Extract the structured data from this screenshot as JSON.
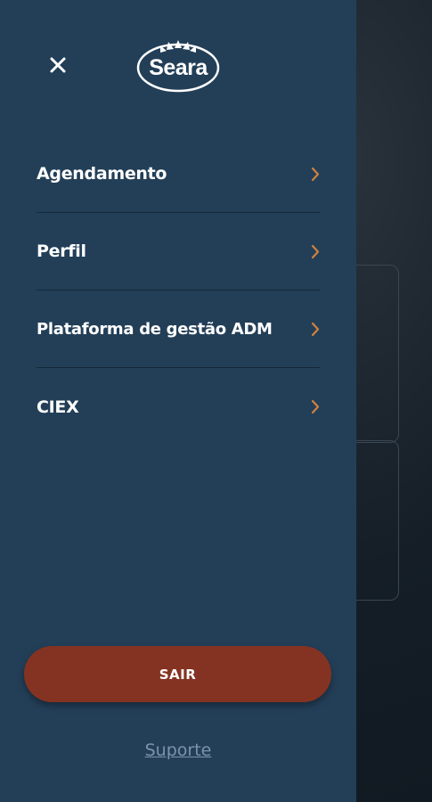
{
  "header": {
    "logo_text": "Seara",
    "close_icon": "close-icon"
  },
  "menu": {
    "items": [
      {
        "label": "Agendamento",
        "icon": "chevron-right-icon"
      },
      {
        "label": "Perfil",
        "icon": "chevron-right-icon"
      },
      {
        "label": "Plataforma de gestão ADM",
        "icon": "chevron-right-icon"
      },
      {
        "label": "CIEX",
        "icon": "chevron-right-icon"
      }
    ]
  },
  "footer": {
    "logout_label": "SAIR",
    "support_link": "Suporte"
  },
  "colors": {
    "drawer_bg": "#233f58",
    "accent_chevron": "#d0823e",
    "logout_bg": "#843322",
    "support_link": "#7d93a8"
  }
}
